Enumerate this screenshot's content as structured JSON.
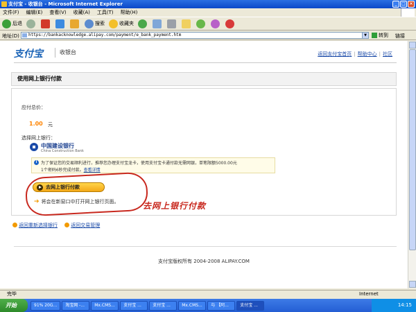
{
  "window": {
    "title": "支付宝 - 收银台 - Microsoft Internet Explorer"
  },
  "menu": [
    "文件(F)",
    "编辑(E)",
    "查看(V)",
    "收藏(A)",
    "工具(T)",
    "帮助(H)"
  ],
  "toolbar": {
    "back": "后退",
    "search": "搜索",
    "favorites": "收藏夹"
  },
  "address": {
    "label": "地址(D)",
    "url": "https://bankacknowledge.alipay.com/payment/e_bank_payment.htm",
    "go": "转到",
    "links": "链接"
  },
  "header": {
    "logo": "支付宝",
    "sub": "收银台",
    "links": [
      "返回支付宝首页",
      "帮助中心",
      "社区"
    ]
  },
  "panel": {
    "title": "使用网上银行付款",
    "pay_label": "应付总价：",
    "amount": "1.00",
    "unit": "元",
    "select_label": "选择网上银行：",
    "bank_name": "中国建设银行",
    "bank_en": "China Construction Bank",
    "notice_line1": "为了保证您的交易顺利进行，推荐您办理支付宝龙卡，使用支付宝卡通付款无需网银，单笔限额5000.00元",
    "notice_line2": "1个密码6秒完成付款。",
    "notice_link": "查看详情",
    "pay_button": "去网上银行付款",
    "hint": "将会在新窗口中打开网上银行页面。"
  },
  "annotation": "去网上银行付款",
  "backlinks": [
    "返回重新选择银行",
    "返回交易管理"
  ],
  "footer": {
    "copyright": "支付宝版权所有 2004-2008 ALIPAY.COM"
  },
  "status": {
    "left": "完毕",
    "zone": "Internet"
  },
  "taskbar": {
    "start": "开始",
    "tasks": [
      "91% 20G...",
      "淘宝网 -...",
      "Mx.CMS...",
      "支付宝 ...",
      "支付宝 ...",
      "Mx.CMS...",
      "与 【阿...",
      "支付宝 ..."
    ],
    "clock": "14:15"
  },
  "colors": {
    "accent": "#1b64b7",
    "amount": "#ff8400",
    "annotation": "#c8281e"
  }
}
